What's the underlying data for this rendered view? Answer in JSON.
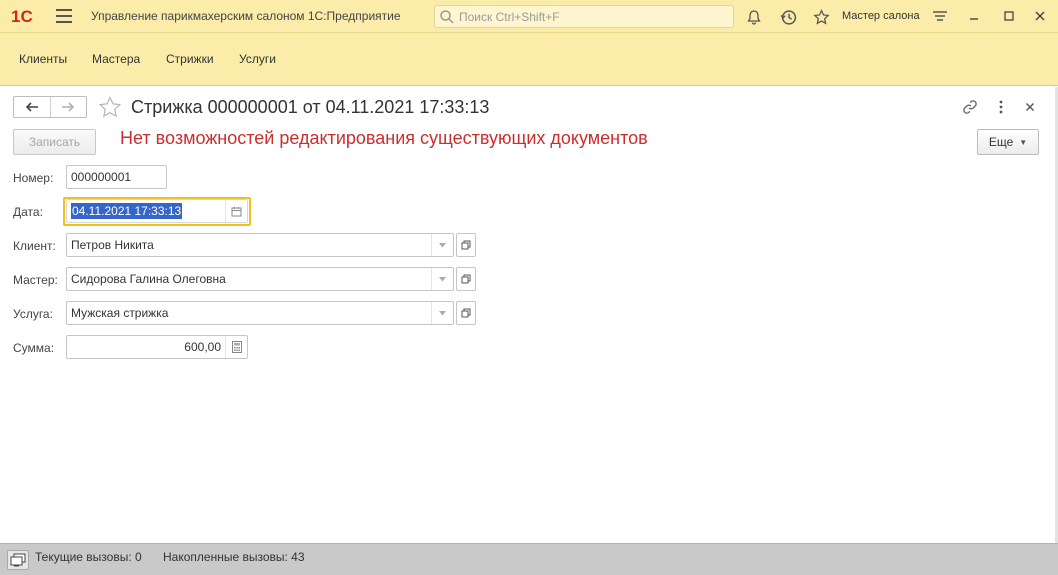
{
  "app": {
    "logo_text": "1С",
    "title": "Управление парикмахерским салоном 1С:Предприятие",
    "search_placeholder": "Поиск Ctrl+Shift+F",
    "user": "Мастер салона"
  },
  "sections": [
    "Клиенты",
    "Мастера",
    "Стрижки",
    "Услуги"
  ],
  "form": {
    "title": "Стрижка 000000001 от 04.11.2021 17:33:13",
    "write_button": "Записать",
    "warning": "Нет возможностей редактирования существующих документов",
    "more_button": "Еще",
    "fields": {
      "number": {
        "label": "Номер:",
        "value": "000000001"
      },
      "date": {
        "label": "Дата:",
        "value": "04.11.2021 17:33:13"
      },
      "client": {
        "label": "Клиент:",
        "value": "Петров Никита"
      },
      "master": {
        "label": "Мастер:",
        "value": "Сидорова Галина Олеговна"
      },
      "service": {
        "label": "Услуга:",
        "value": "Мужская стрижка"
      },
      "sum": {
        "label": "Сумма:",
        "value": "600,00"
      }
    }
  },
  "status": {
    "current_calls": "Текущие вызовы: 0",
    "accumulated_calls": "Накопленные вызовы: 43"
  },
  "colors": {
    "panel": "#fbeda9",
    "warning": "#cc2d2d",
    "focus": "#f0c020",
    "selection": "#3565c9"
  }
}
